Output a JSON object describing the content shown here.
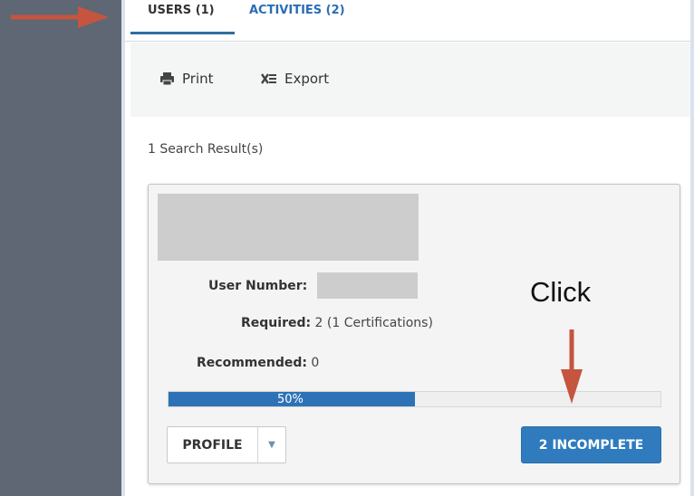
{
  "tabs": [
    {
      "label": "USERS (1)"
    },
    {
      "label": "ACTIVITIES (2)"
    }
  ],
  "toolbar": {
    "print_label": "Print",
    "export_label": "Export"
  },
  "results": {
    "count_text": "1 Search Result(s)"
  },
  "card": {
    "user_number_label": "User Number:",
    "required_label": "Required:",
    "required_value": "2 (1 Certifications)",
    "recommended_label": "Recommended:",
    "recommended_value": "0",
    "progress_percent": 50,
    "progress_text": "50%",
    "profile_label": "PROFILE",
    "incomplete_label": "2 INCOMPLETE"
  },
  "annotation": {
    "click_text": "Click"
  },
  "colors": {
    "sidebar": "#5f6774",
    "accent_blue": "#2f7bbe",
    "arrow_red": "#c5553f",
    "tab_link": "#2a6db5"
  },
  "icons": {
    "print": "printer-icon",
    "export": "excel-export-icon",
    "caret": "chevron-down-icon"
  }
}
